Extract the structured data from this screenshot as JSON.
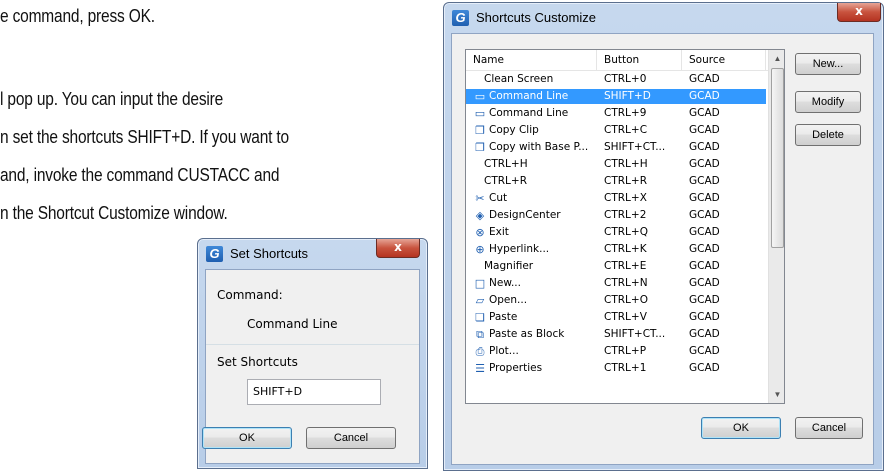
{
  "document": {
    "lines": [
      "e command, press OK.",
      "l pop up. You can input the desire",
      "n set the shortcuts SHIFT+D. If you want to",
      "and, invoke the command CUSTACC and",
      "n the Shortcut Customize window."
    ]
  },
  "set_shortcuts_dialog": {
    "title": "Set Shortcuts",
    "app_icon": "G",
    "close_glyph": "x",
    "command_label": "Command:",
    "command_value": "Command Line",
    "shortcut_label": "Set Shortcuts",
    "shortcut_value": "SHIFT+D",
    "ok_label": "OK",
    "cancel_label": "Cancel"
  },
  "shortcuts_customize_dialog": {
    "title": "Shortcuts Customize",
    "app_icon": "G",
    "close_glyph": "x",
    "columns": [
      "Name",
      "Button",
      "Source"
    ],
    "rows": [
      {
        "icon": "",
        "name": "Clean Screen",
        "button": "CTRL+0",
        "source": "GCAD"
      },
      {
        "icon": "command-line-icon",
        "glyph": "▭",
        "name": "Command Line",
        "button": "SHIFT+D",
        "source": "GCAD",
        "selected": true
      },
      {
        "icon": "command-line-icon",
        "glyph": "▭",
        "name": "Command Line",
        "button": "CTRL+9",
        "source": "GCAD"
      },
      {
        "icon": "copy-clip-icon",
        "glyph": "❐",
        "name": "Copy Clip",
        "button": "CTRL+C",
        "source": "GCAD"
      },
      {
        "icon": "copy-base-point-icon",
        "glyph": "❐",
        "name": "Copy with Base P...",
        "button": "SHIFT+CT...",
        "source": "GCAD"
      },
      {
        "icon": "",
        "name": "CTRL+H",
        "button": "CTRL+H",
        "source": "GCAD"
      },
      {
        "icon": "",
        "name": "CTRL+R",
        "button": "CTRL+R",
        "source": "GCAD"
      },
      {
        "icon": "cut-icon",
        "glyph": "✂",
        "name": "Cut",
        "button": "CTRL+X",
        "source": "GCAD"
      },
      {
        "icon": "design-center-icon",
        "glyph": "◈",
        "name": "DesignCenter",
        "button": "CTRL+2",
        "source": "GCAD"
      },
      {
        "icon": "exit-icon",
        "glyph": "⊗",
        "name": "Exit",
        "button": "CTRL+Q",
        "source": "GCAD"
      },
      {
        "icon": "hyperlink-icon",
        "glyph": "⊕",
        "name": "Hyperlink...",
        "button": "CTRL+K",
        "source": "GCAD"
      },
      {
        "icon": "",
        "name": "Magnifier",
        "button": "CTRL+E",
        "source": "GCAD"
      },
      {
        "icon": "new-file-icon",
        "glyph": "□",
        "name": "New...",
        "button": "CTRL+N",
        "source": "GCAD"
      },
      {
        "icon": "open-folder-icon",
        "glyph": "▱",
        "name": "Open...",
        "button": "CTRL+O",
        "source": "GCAD"
      },
      {
        "icon": "paste-icon",
        "glyph": "❏",
        "name": "Paste",
        "button": "CTRL+V",
        "source": "GCAD"
      },
      {
        "icon": "paste-block-icon",
        "glyph": "⧉",
        "name": "Paste as Block",
        "button": "SHIFT+CT...",
        "source": "GCAD"
      },
      {
        "icon": "plot-icon",
        "glyph": "⎙",
        "name": "Plot...",
        "button": "CTRL+P",
        "source": "GCAD"
      },
      {
        "icon": "properties-icon",
        "glyph": "☰",
        "name": "Properties",
        "button": "CTRL+1",
        "source": "GCAD"
      }
    ],
    "new_label": "New...",
    "modify_label": "Modify",
    "delete_label": "Delete",
    "ok_label": "OK",
    "cancel_label": "Cancel"
  }
}
